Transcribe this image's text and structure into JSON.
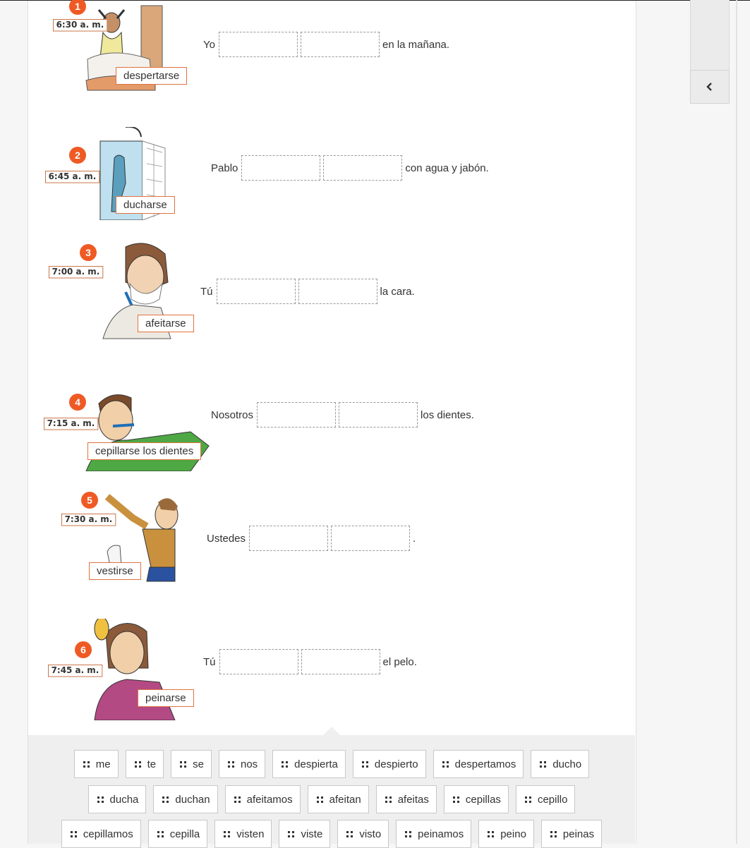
{
  "sidebar": {
    "collapse_icon": "chevron-left-icon"
  },
  "items": [
    {
      "num": "1",
      "time": "6:30 a. m.",
      "verb": "despertarse",
      "subject": "Yo",
      "after": "en la mañana."
    },
    {
      "num": "2",
      "time": "6:45 a. m.",
      "verb": "ducharse",
      "subject": "Pablo",
      "after": "con agua y jabón."
    },
    {
      "num": "3",
      "time": "7:00 a. m.",
      "verb": "afeitarse",
      "subject": "Tú",
      "after": "la cara."
    },
    {
      "num": "4",
      "time": "7:15 a. m.",
      "verb": "cepillarse los dientes",
      "subject": "Nosotros",
      "after": "los dientes."
    },
    {
      "num": "5",
      "time": "7:30 a. m.",
      "verb": "vestirse",
      "subject": "Ustedes",
      "after": "."
    },
    {
      "num": "6",
      "time": "7:45 a. m.",
      "verb": "peinarse",
      "subject": "Tú",
      "after": "el pelo."
    }
  ],
  "word_bank": [
    [
      "me",
      "te",
      "se",
      "nos",
      "despierta",
      "despierto",
      "despertamos",
      "ducho"
    ],
    [
      "ducha",
      "duchan",
      "afeitamos",
      "afeitan",
      "afeitas",
      "cepillas",
      "cepillo"
    ],
    [
      "cepillamos",
      "cepilla",
      "visten",
      "viste",
      "visto",
      "peinamos",
      "peino",
      "peinas"
    ]
  ],
  "colors": {
    "accent": "#ef5a24",
    "label_border": "#e0733e",
    "bank_bg": "#efefef"
  }
}
